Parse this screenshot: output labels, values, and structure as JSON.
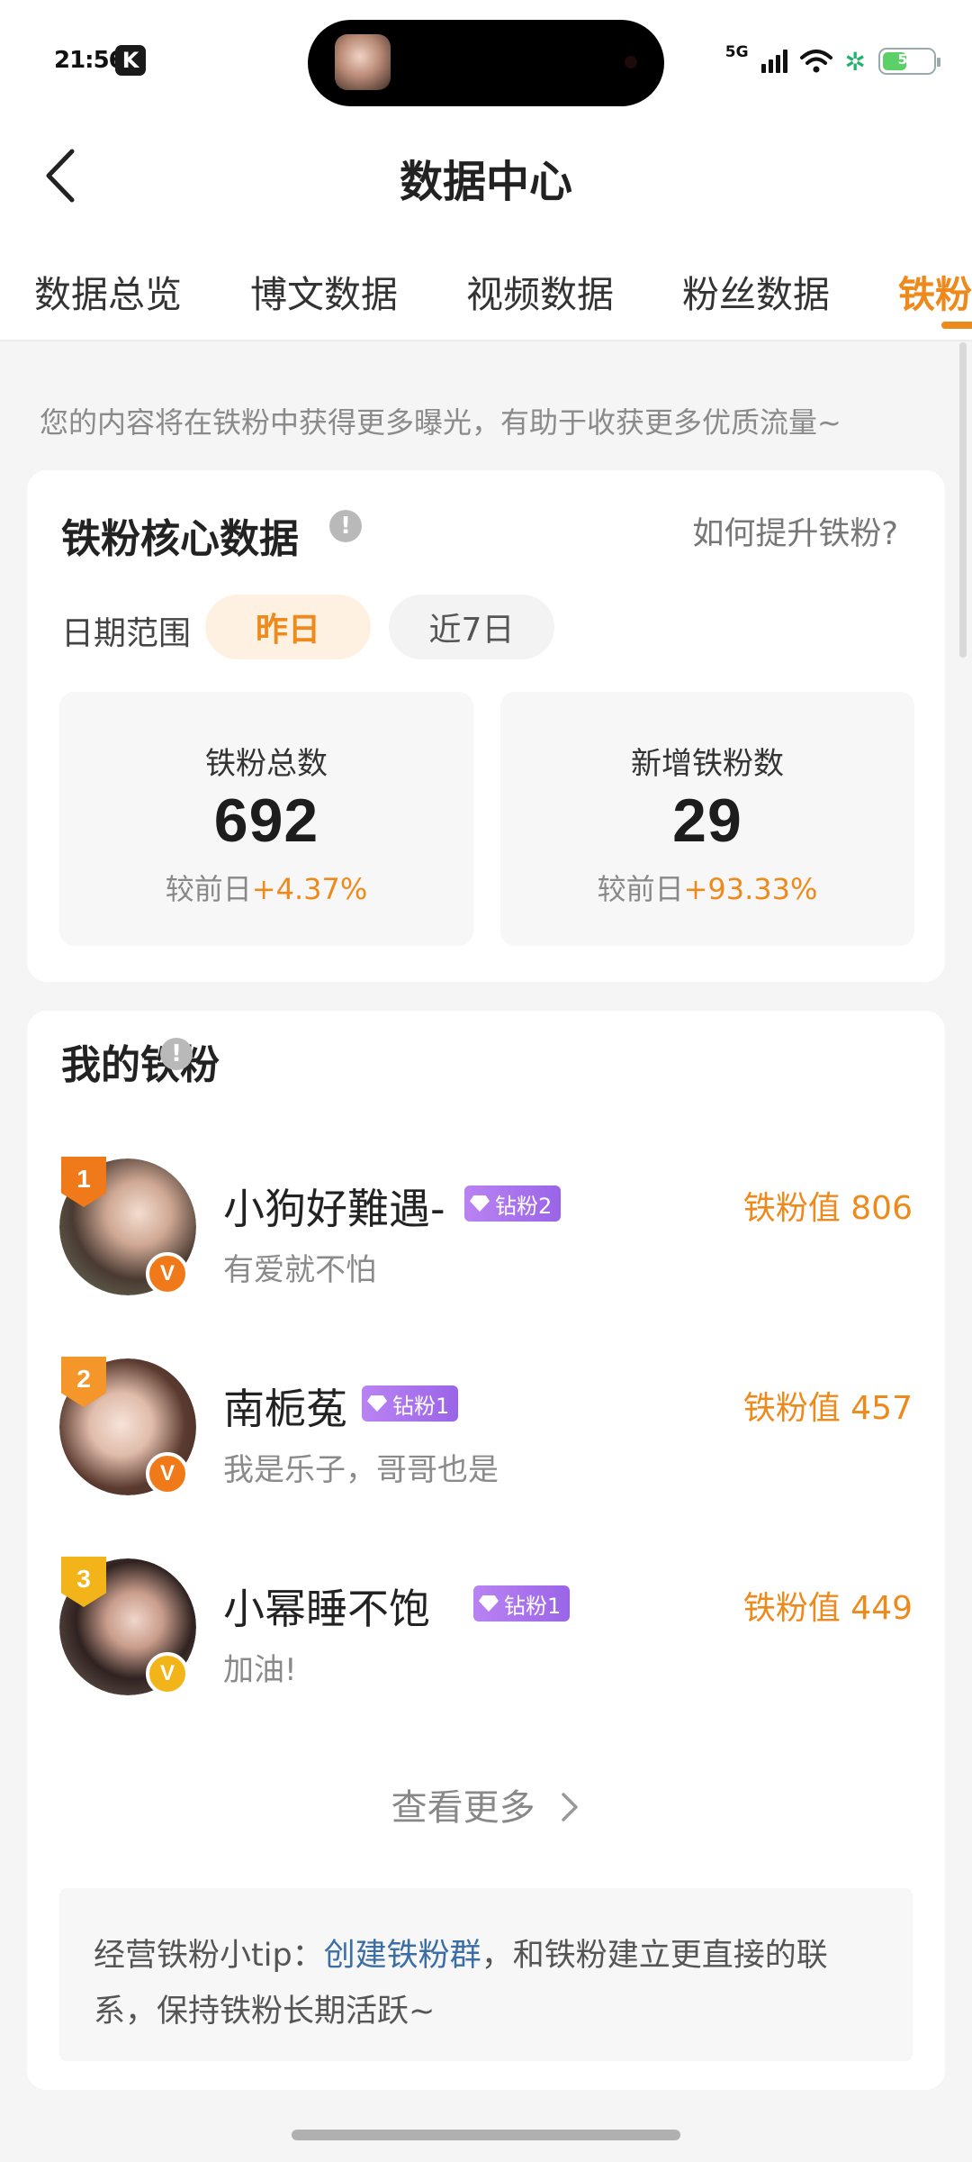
{
  "status_bar": {
    "time": "21:56",
    "app_badge": "K",
    "network": "5G",
    "battery": "51",
    "colors": {
      "battery_fill": "#5bd066",
      "eco": "#21b36b"
    }
  },
  "header": {
    "title": "数据中心"
  },
  "tabs": [
    {
      "label": "数据总览"
    },
    {
      "label": "博文数据"
    },
    {
      "label": "视频数据"
    },
    {
      "label": "粉丝数据"
    },
    {
      "label": "铁粉"
    }
  ],
  "hint": "您的内容将在铁粉中获得更多曝光，有助于收获更多优质流量~",
  "core": {
    "title": "铁粉核心数据",
    "how_link": "如何提升铁粉?",
    "date_range_label": "日期范围",
    "chips": [
      {
        "label": "昨日",
        "selected": true
      },
      {
        "label": "近7日",
        "selected": false
      }
    ],
    "stats": [
      {
        "label": "铁粉总数",
        "value": "692",
        "compare_prefix": "较前日",
        "compare_value": "+4.37%"
      },
      {
        "label": "新增铁粉数",
        "value": "29",
        "compare_prefix": "较前日",
        "compare_value": "+93.33%"
      }
    ]
  },
  "fans": {
    "title": "我的铁粉",
    "items": [
      {
        "rank": "1",
        "name": "小狗好難遇-",
        "level": "钻粉2",
        "bio": "有爱就不怕",
        "score": "铁粉值 806",
        "verified_color": "#f07a1a",
        "rank_color": "#f07a1a"
      },
      {
        "rank": "2",
        "name": "南栀菟",
        "level": "钻粉1",
        "bio": "我是乐子，哥哥也是",
        "score": "铁粉值 457",
        "verified_color": "#f07a1a",
        "rank_color": "#f5962a"
      },
      {
        "rank": "3",
        "name": "小幂睡不饱",
        "level": "钻粉1",
        "bio": "加油!",
        "score": "铁粉值 449",
        "verified_color": "#f2b418",
        "rank_color": "#f2b418"
      }
    ],
    "view_more": "查看更多",
    "tip_prefix": "经营铁粉小tip：",
    "tip_link": "创建铁粉群",
    "tip_suffix": "，和铁粉建立更直接的联系，保持铁粉长期活跃~"
  },
  "colors": {
    "accent": "#ee8a1c",
    "link": "#3a6ea5",
    "level_badge": "#a774ee"
  }
}
